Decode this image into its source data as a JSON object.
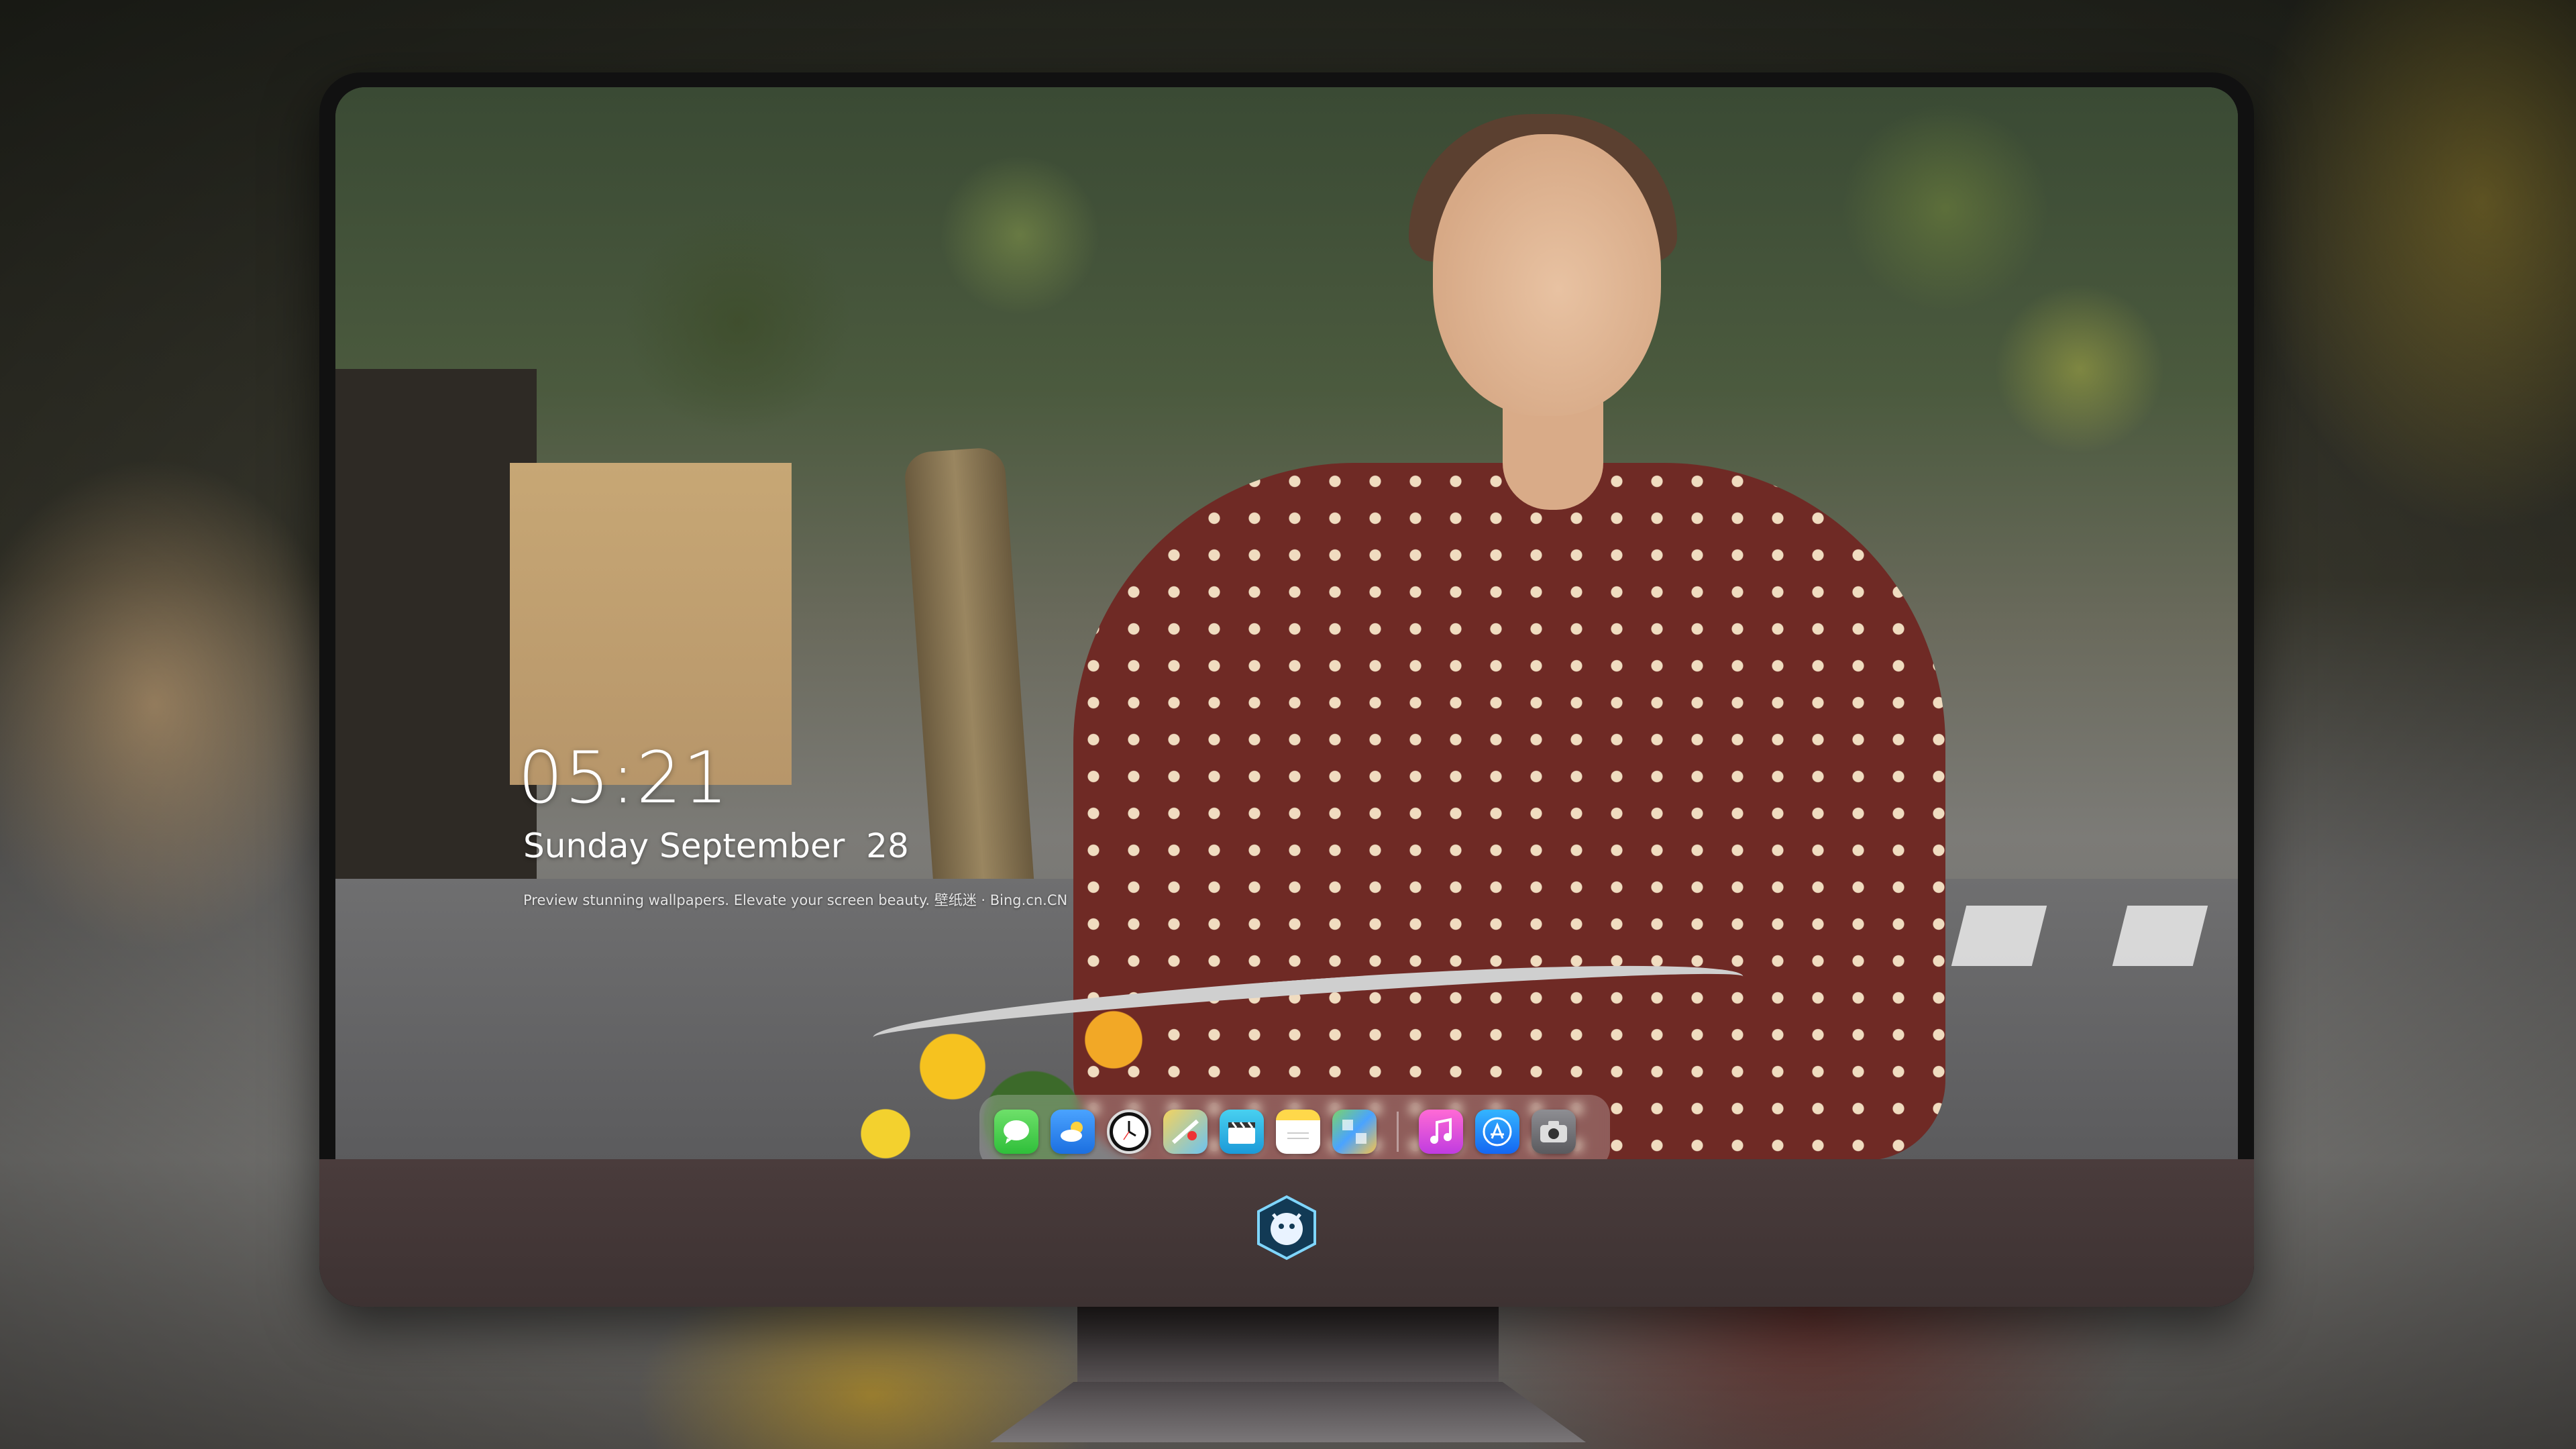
{
  "lockscreen": {
    "time": "05:21",
    "date": "Sunday September  28",
    "caption": "Preview stunning wallpapers. Elevate your screen beauty. 壁纸迷 · Bing.cn.CN"
  },
  "dock": {
    "apps": [
      {
        "name": "Messages",
        "icon": "message-bubble-icon"
      },
      {
        "name": "Weather",
        "icon": "cloud-sun-icon"
      },
      {
        "name": "Clock",
        "icon": "clock-icon"
      },
      {
        "name": "Maps",
        "icon": "map-icon"
      },
      {
        "name": "Clips",
        "icon": "clapperboard-icon"
      },
      {
        "name": "Notes",
        "icon": "notes-icon"
      },
      {
        "name": "Photos",
        "icon": "photos-icon"
      },
      {
        "name": "Music",
        "icon": "music-note-icon"
      },
      {
        "name": "App Store",
        "icon": "app-store-icon"
      },
      {
        "name": "Camera",
        "icon": "camera-icon"
      }
    ]
  },
  "monitor": {
    "chin_logo": "mascot-logo-icon"
  }
}
